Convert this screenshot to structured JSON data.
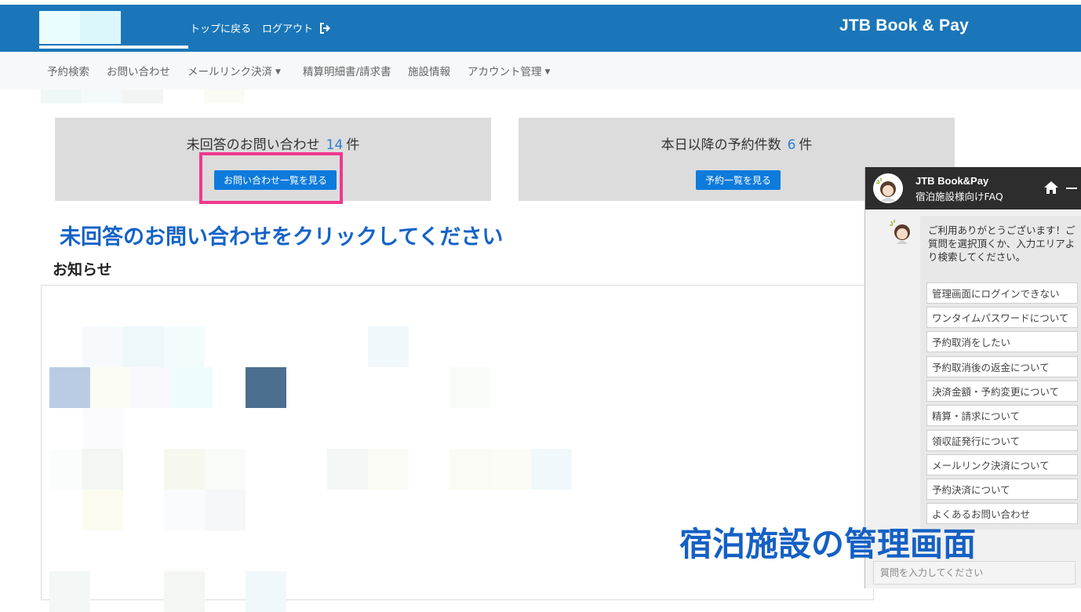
{
  "header": {
    "top_link": "トップに戻る",
    "logout_link": "ログアウト",
    "brand": "JTB Book & Pay"
  },
  "nav": {
    "items": [
      {
        "label": "予約検索",
        "dropdown": false
      },
      {
        "label": "お問い合わせ",
        "dropdown": false
      },
      {
        "label": "メールリンク決済",
        "dropdown": true
      },
      {
        "label": "精算明細書/請求書",
        "dropdown": false
      },
      {
        "label": "施設情報",
        "dropdown": false
      },
      {
        "label": "アカウント管理",
        "dropdown": true
      }
    ]
  },
  "cards": {
    "inquiries": {
      "label": "未回答のお問い合わせ",
      "count": "14",
      "unit": "件",
      "button": "お問い合わせ一覧を見る"
    },
    "reservations": {
      "label": "本日以降の予約件数",
      "count": "6",
      "unit": "件",
      "button": "予約一覧を見る"
    }
  },
  "annotation_click": "未回答のお問い合わせをクリックしてください",
  "notice": {
    "title": "お知らせ"
  },
  "chat": {
    "title_line1": "JTB Book&Pay",
    "title_line2": "宿泊施設様向けFAQ",
    "greeting": "ご利用ありがとうございます！ご質問を選択頂くか、入力エリアより検索してください。",
    "faq_items": [
      "管理画面にログインできない",
      "ワンタイムパスワードについて",
      "予約取消をしたい",
      "予約取消後の返金について",
      "決済金額・予約変更について",
      "精算・請求について",
      "領収証発行について",
      "メールリンク決済について",
      "予約決済について",
      "よくあるお問い合わせ"
    ],
    "input_placeholder": "質問を入力してください"
  },
  "annotation_admin": "宿泊施設の管理画面",
  "colors": {
    "header_bg": "#1a76b9",
    "button_blue": "#0d7bdc",
    "highlight_pink": "#f0388e",
    "annotation_blue": "#1563c8",
    "chat_header": "#2d2d2d"
  }
}
